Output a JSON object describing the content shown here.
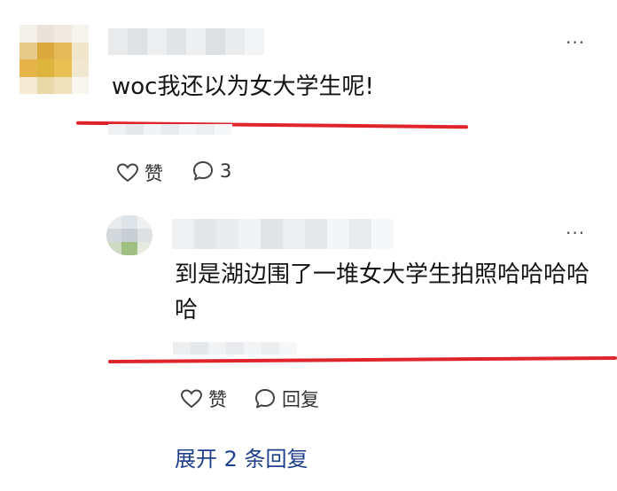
{
  "comment": {
    "text": "woc我还以为女大学生呢!",
    "like_label": "赞",
    "reply_count": "3",
    "more_icon": "···"
  },
  "reply": {
    "text": "到是湖边围了一堆女大学生拍照哈哈哈哈哈",
    "like_label": "赞",
    "reply_label": "回复",
    "more_icon": "···"
  },
  "expand_label": "展开 2 条回复",
  "colors": {
    "underline": "#e0242c",
    "expand_link": "#1f3f8a"
  }
}
